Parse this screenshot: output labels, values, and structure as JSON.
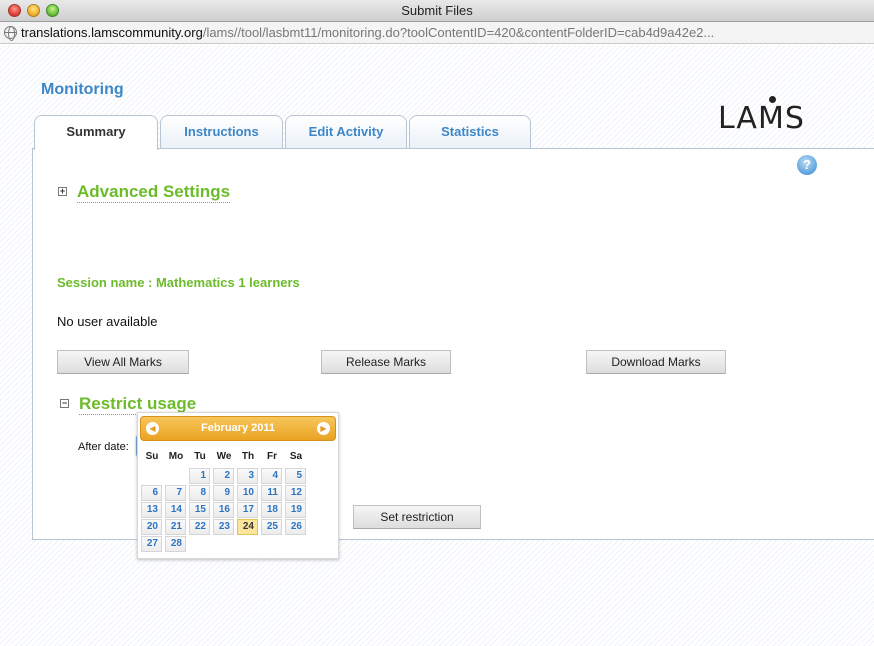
{
  "window": {
    "title": "Submit Files"
  },
  "urlbar": {
    "host": "translations.lamscommunity.org",
    "path": "/lams//tool/lasbmt11/monitoring.do?toolContentID=420&contentFolderID=cab4d9a42e2..."
  },
  "page": {
    "heading": "Monitoring",
    "logo_text": "LAMS"
  },
  "tabs": [
    {
      "label": "Summary",
      "active": true
    },
    {
      "label": "Instructions",
      "active": false
    },
    {
      "label": "Edit Activity",
      "active": false
    },
    {
      "label": "Statistics",
      "active": false
    }
  ],
  "help": {
    "glyph": "?"
  },
  "advanced_settings": {
    "toggle": "+",
    "label": "Advanced Settings"
  },
  "session": {
    "label": "Session name : Mathematics 1 learners"
  },
  "status": {
    "no_user": "No user available"
  },
  "buttons": {
    "view_all_marks": "View All Marks",
    "release_marks": "Release Marks",
    "download_marks": "Download Marks",
    "set_restriction": "Set restriction"
  },
  "restrict_usage": {
    "toggle": "−",
    "label": "Restrict usage",
    "after_date_label": "After date:",
    "after_date_value": ""
  },
  "datepicker": {
    "month_title": "February 2011",
    "prev_glyph": "◀",
    "next_glyph": "▶",
    "weekdays": [
      "Su",
      "Mo",
      "Tu",
      "We",
      "Th",
      "Fr",
      "Sa"
    ],
    "first_weekday_index": 2,
    "days_in_month": 28,
    "today": 24
  },
  "colors": {
    "accent_blue": "#3d87c9",
    "accent_green": "#6cbb2b",
    "datepicker_header": "#e9a323",
    "today_highlight": "#fbe59a"
  }
}
